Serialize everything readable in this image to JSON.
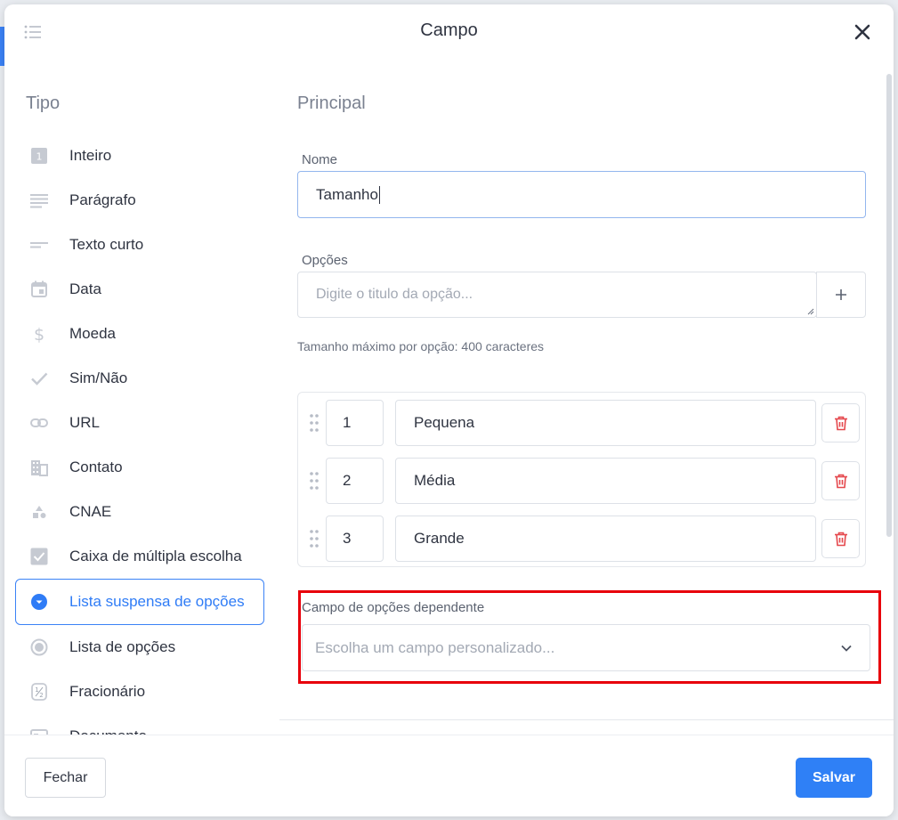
{
  "modal": {
    "title": "Campo",
    "close_icon": "close-icon"
  },
  "type_section": {
    "title": "Tipo",
    "items": [
      {
        "label": "Inteiro",
        "icon": "integer-icon"
      },
      {
        "label": "Parágrafo",
        "icon": "paragraph-icon"
      },
      {
        "label": "Texto curto",
        "icon": "short-text-icon"
      },
      {
        "label": "Data",
        "icon": "calendar-icon"
      },
      {
        "label": "Moeda",
        "icon": "dollar-icon"
      },
      {
        "label": "Sim/Não",
        "icon": "check-icon"
      },
      {
        "label": "URL",
        "icon": "link-icon"
      },
      {
        "label": "Contato",
        "icon": "building-icon"
      },
      {
        "label": "CNAE",
        "icon": "shapes-icon"
      },
      {
        "label": "Caixa de múltipla escolha",
        "icon": "checkbox-icon"
      },
      {
        "label": "Lista suspensa de opções",
        "icon": "dropdown-circle-icon",
        "active": true
      },
      {
        "label": "Lista de opções",
        "icon": "radio-icon"
      },
      {
        "label": "Fracionário",
        "icon": "fraction-icon"
      },
      {
        "label": "Documento",
        "icon": "document-icon"
      }
    ]
  },
  "main": {
    "title": "Principal",
    "name_label": "Nome",
    "name_value": "Tamanho",
    "options_label": "Opções",
    "options_placeholder": "Digite o titulo da opção...",
    "options_hint": "Tamanho máximo por opção: 400 caracteres",
    "options": [
      {
        "order": "1",
        "title": "Pequena"
      },
      {
        "order": "2",
        "title": "Média"
      },
      {
        "order": "3",
        "title": "Grande"
      }
    ],
    "dependent_label": "Campo de opções dependente",
    "dependent_placeholder": "Escolha um campo personalizado..."
  },
  "footer": {
    "close_label": "Fechar",
    "save_label": "Salvar"
  },
  "colors": {
    "accent": "#2f80f6",
    "highlight": "#e8000b",
    "delete": "#e5484d"
  }
}
